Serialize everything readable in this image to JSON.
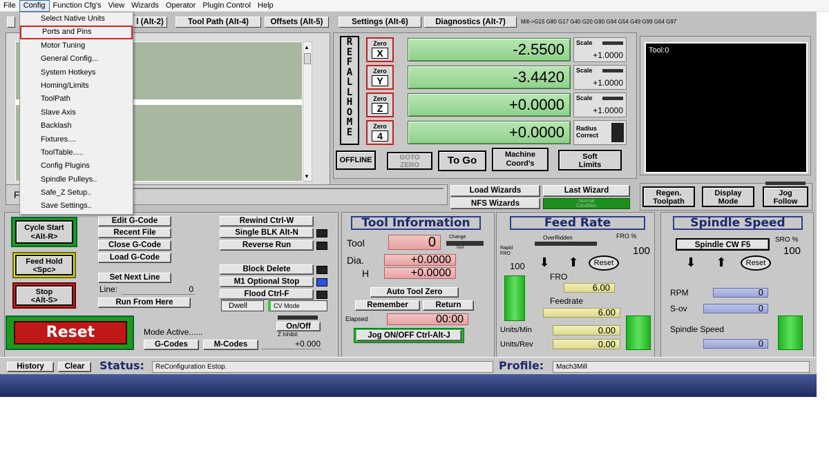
{
  "menubar": [
    "File",
    "Config",
    "Function Cfg's",
    "View",
    "Wizards",
    "Operator",
    "PlugIn Control",
    "Help"
  ],
  "config_menu": [
    "Select Native Units",
    "Ports and Pins",
    "Motor Tuning",
    "General Config...",
    "System Hotkeys",
    "Homing/Limits",
    "ToolPath",
    "Slave Axis",
    "Backlash",
    "Fixtures....",
    "ToolTable.....",
    "Config Plugins",
    "Spindle Pulleys..",
    "Safe_Z Setup..",
    "Save Settings.."
  ],
  "tabs": {
    "t2": "l (Alt-2)",
    "t4": "Tool Path (Alt-4)",
    "t5": "Offsets (Alt-5)",
    "t6": "Settings (Alt-6)",
    "t7": "Diagnostics (Alt-7)"
  },
  "gcode_modes": "Mill->G15  G80 G17 G40 G20 G90 G94 G54 G49 G99 G64 G97",
  "ref_all_home": [
    "R",
    "E",
    "F",
    "A",
    "L",
    "L",
    "H",
    "O",
    "M",
    "E"
  ],
  "axes": [
    {
      "zero": "Zero",
      "axis": "X",
      "value": "-2.5500",
      "scale_label": "Scale",
      "scale": "+1.0000"
    },
    {
      "zero": "Zero",
      "axis": "Y",
      "value": "-3.4420",
      "scale_label": "Scale",
      "scale": "+1.0000"
    },
    {
      "zero": "Zero",
      "axis": "Z",
      "value": "+0.0000",
      "scale_label": "Scale",
      "scale": "+1.0000"
    },
    {
      "zero": "Zero",
      "axis": "4",
      "value": "+0.0000",
      "scale_label": "Radius",
      "scale": "Correct"
    }
  ],
  "dro_buttons": {
    "offline": "OFFLINE",
    "goto_zero_1": "GOTO",
    "goto_zero_2": "ZERO",
    "to_go": "To Go",
    "machine_1": "Machine",
    "machine_2": "Coord's",
    "soft_1": "Soft",
    "soft_2": "Limits"
  },
  "tool_display": "Tool:0",
  "file_label": "F",
  "wizards": {
    "load": "Load Wizards",
    "last": "Last Wizard",
    "nfs": "NFS Wizards",
    "normal_1": "Normal",
    "normal_2": "Condition"
  },
  "view_buttons": {
    "regen_1": "Regen.",
    "regen_2": "Toolpath",
    "display_1": "Display",
    "display_2": "Mode",
    "jog_1": "Jog",
    "jog_2": "Follow"
  },
  "control": {
    "cycle_1": "Cycle Start",
    "cycle_2": "<Alt-R>",
    "feedhold_1": "Feed Hold",
    "feedhold_2": "<Spc>",
    "stop_1": "Stop",
    "stop_2": "<Alt-S>",
    "reset": "Reset"
  },
  "file_buttons": {
    "edit": "Edit G-Code",
    "recent": "Recent File",
    "close": "Close G-Code",
    "load": "Load G-Code",
    "set_next": "Set Next Line",
    "line": "Line:",
    "line_val": "0",
    "run_from": "Run From Here"
  },
  "run_buttons": {
    "rewind": "Rewind Ctrl-W",
    "single": "Single BLK Alt-N",
    "reverse": "Reverse Run",
    "block_delete": "Block Delete",
    "m1": "M1 Optional Stop",
    "flood": "Flood Ctrl-F",
    "dwell": "Dwell",
    "cv": "CV Mode"
  },
  "mode": {
    "active": "Mode Active......",
    "onoff": "On/Off",
    "zinhibit": "Z Inhibit",
    "zval": "+0.000",
    "gcodes": "G-Codes",
    "mcodes": "M-Codes"
  },
  "tool_info": {
    "title": "Tool Information",
    "tool": "Tool",
    "tool_val": "0",
    "change_1": "Change",
    "change_2": "Tool",
    "dia": "Dia.",
    "dia_val": "+0.0000",
    "h": "H",
    "h_val": "+0.0000",
    "auto_zero": "Auto Tool Zero",
    "remember": "Remember",
    "return": "Return",
    "elapsed": "Elapsed",
    "elapsed_val": "00:00",
    "jog": "Jog ON/OFF Ctrl-Alt-J"
  },
  "feed": {
    "title": "Feed Rate",
    "overridden": "OverRidden",
    "fro_pct": "FRO %",
    "fro_pct_val": "100",
    "rapid_1": "Rapid",
    "rapid_2": "FRO",
    "rapid_val": "100",
    "reset": "Reset",
    "fro": "FRO",
    "fro_val": "6.00",
    "feedrate": "Feedrate",
    "feedrate_val": "6.00",
    "upm": "Units/Min",
    "upm_val": "0.00",
    "upr": "Units/Rev",
    "upr_val": "0.00"
  },
  "spindle": {
    "title": "Spindle Speed",
    "cw": "Spindle CW F5",
    "sro": "SRO %",
    "sro_val": "100",
    "reset": "Reset",
    "rpm": "RPM",
    "rpm_val": "0",
    "sov": "S-ov",
    "sov_val": "0",
    "speed": "Spindle Speed",
    "speed_val": "0"
  },
  "statusbar": {
    "history": "History",
    "clear": "Clear",
    "status": "Status:",
    "status_msg": "ReConfiguration Estop.",
    "profile": "Profile:",
    "profile_val": "Mach3Mill"
  }
}
